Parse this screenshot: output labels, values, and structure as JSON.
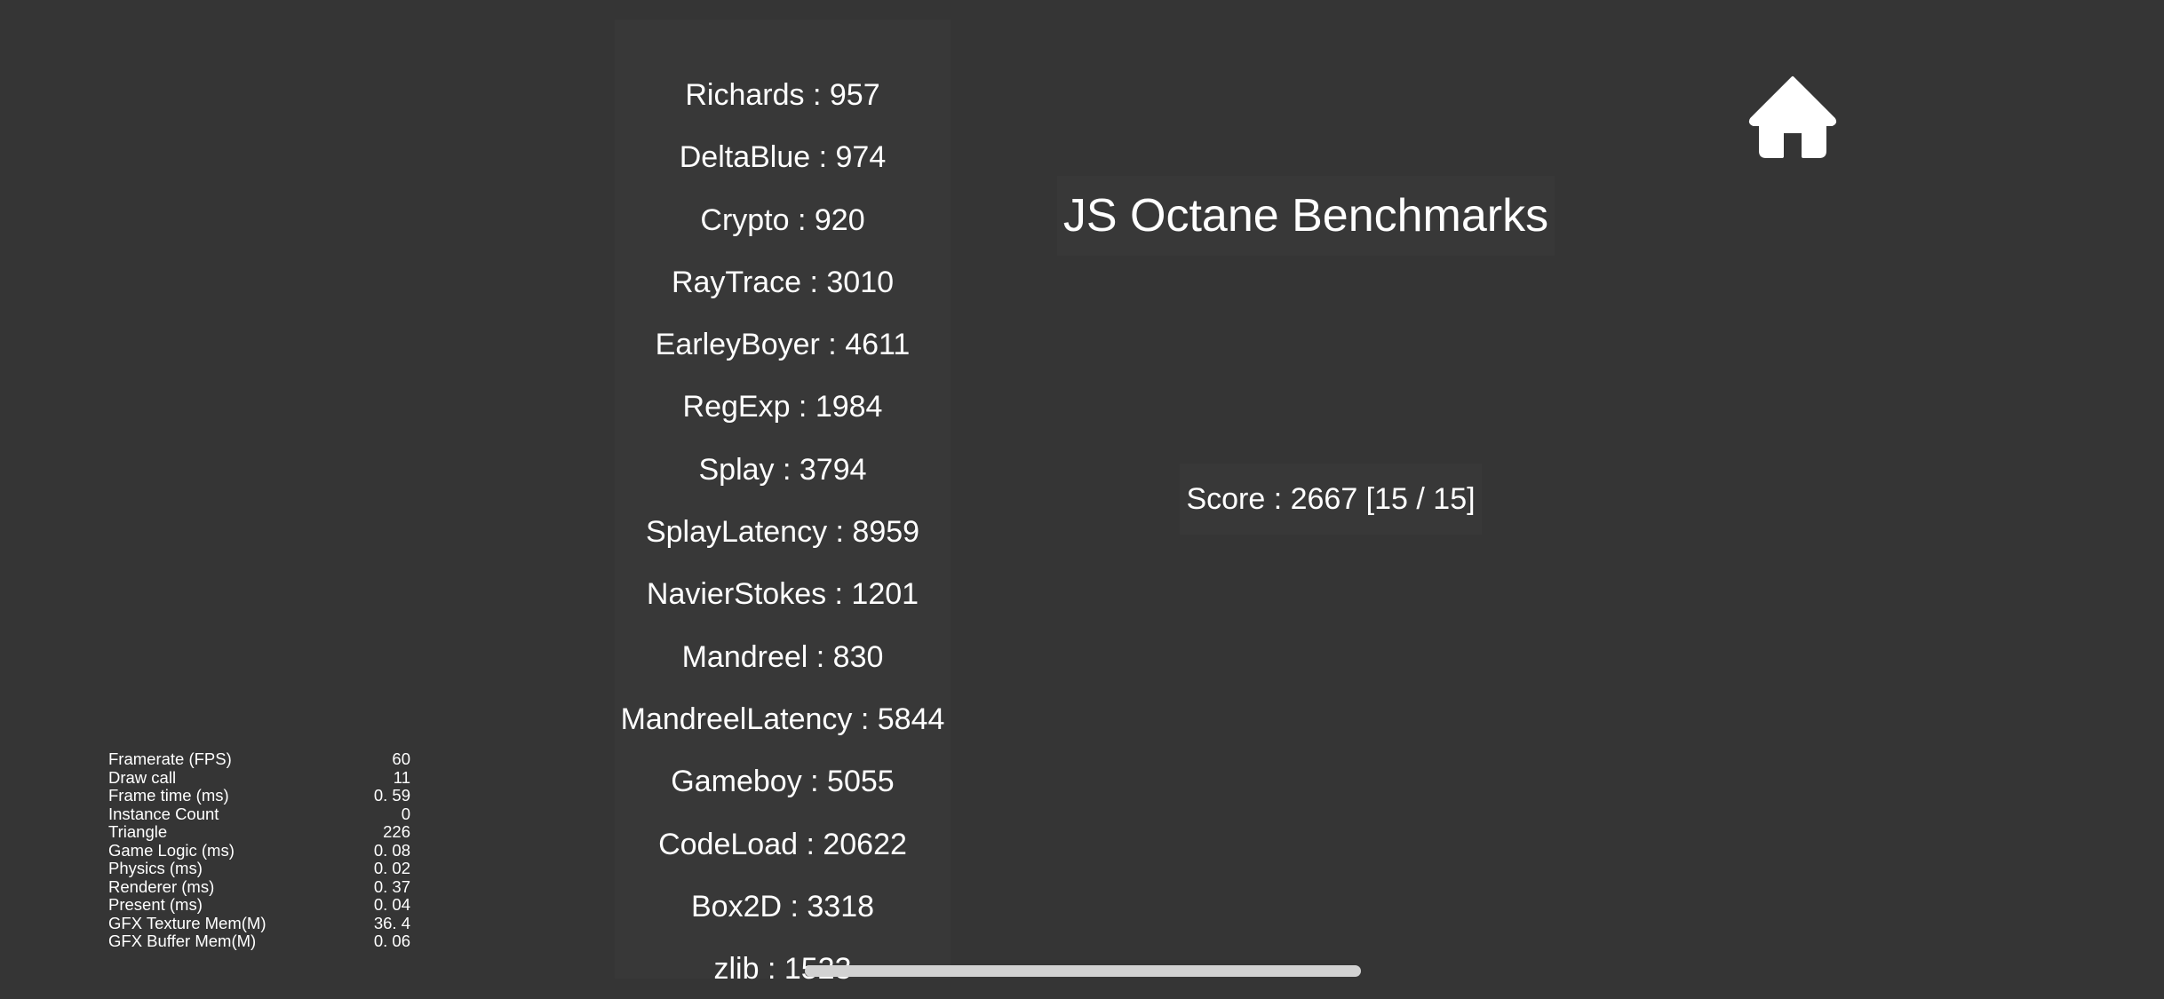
{
  "title": "JS Octane Benchmarks",
  "score": "Score : 2667 [15 / 15]",
  "home_icon": "home-icon",
  "benchmarks": [
    "Richards : 957",
    "DeltaBlue : 974",
    "Crypto : 920",
    "RayTrace : 3010",
    "EarleyBoyer : 4611",
    "RegExp : 1984",
    "Splay : 3794",
    "SplayLatency : 8959",
    "NavierStokes : 1201",
    "Mandreel : 830",
    "MandreelLatency : 5844",
    "Gameboy : 5055",
    "CodeLoad : 20622",
    "Box2D : 3318",
    "zlib : 1523"
  ],
  "stats": [
    {
      "label": "Framerate (FPS)",
      "value": "60"
    },
    {
      "label": "Draw call",
      "value": "11"
    },
    {
      "label": "Frame time (ms)",
      "value": "0. 59"
    },
    {
      "label": "Instance Count",
      "value": "0"
    },
    {
      "label": "Triangle",
      "value": "226"
    },
    {
      "label": "Game Logic (ms)",
      "value": "0. 08"
    },
    {
      "label": "Physics (ms)",
      "value": "0. 02"
    },
    {
      "label": "Renderer (ms)",
      "value": "0. 37"
    },
    {
      "label": "Present (ms)",
      "value": "0. 04"
    },
    {
      "label": "GFX Texture Mem(M)",
      "value": "36. 4"
    },
    {
      "label": "GFX Buffer Mem(M)",
      "value": "0. 06"
    }
  ],
  "colors": {
    "background": "#353535",
    "panel": "#383838",
    "text": "#ffffff",
    "indicator": "#d2d2d2"
  }
}
